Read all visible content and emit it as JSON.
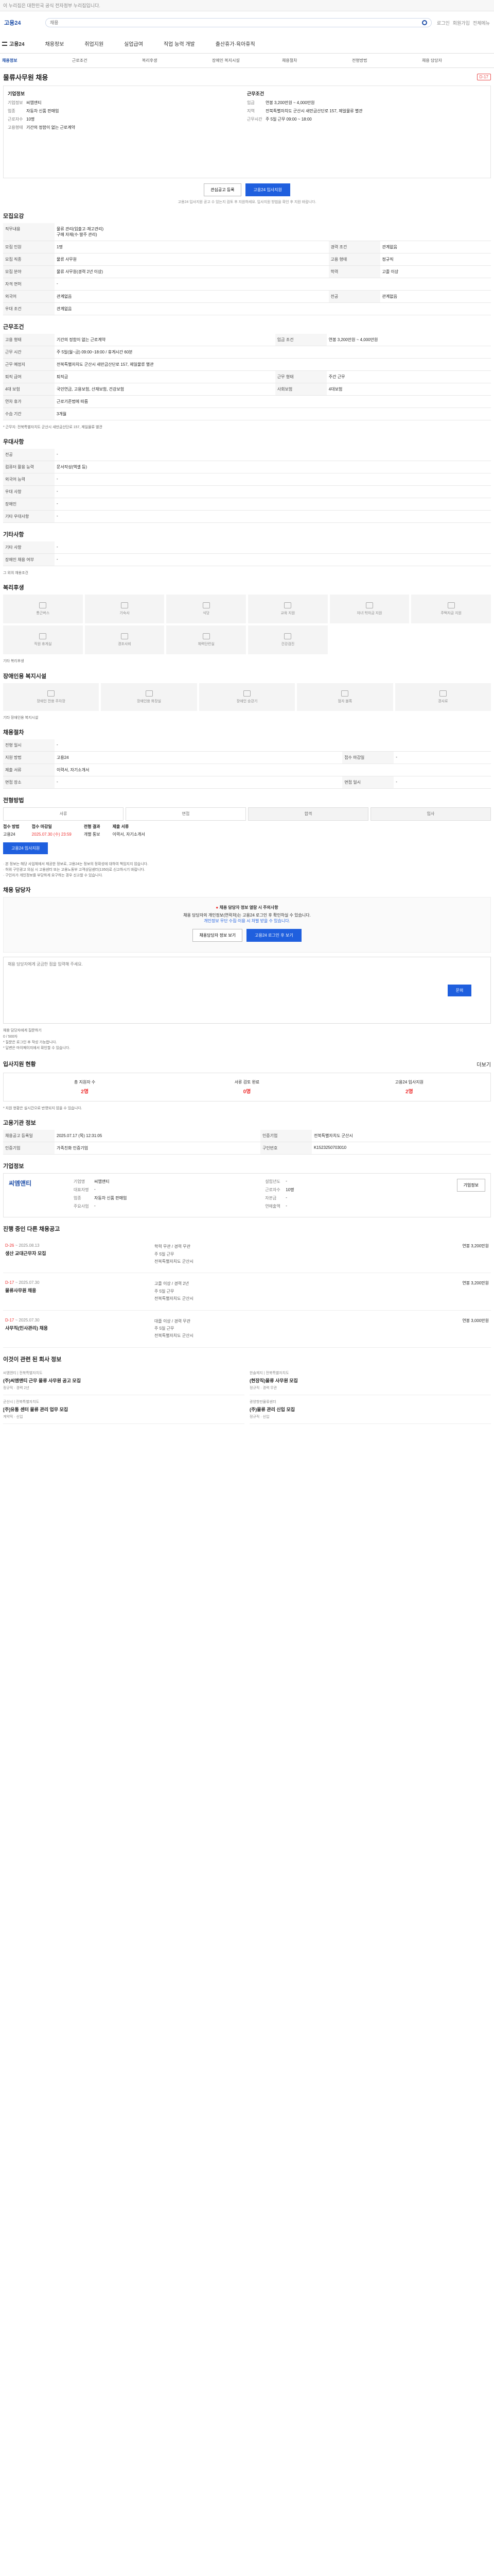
{
  "topbar": {
    "text": "이 누리집은 대한민국 공식 전자정부 누리집입니다."
  },
  "header": {
    "logo": "고용24",
    "search_placeholder": "채용",
    "icons": [
      "로그인",
      "회원가입",
      "전체메뉴"
    ]
  },
  "gnb": [
    "고용24",
    "채용정보",
    "취업지원",
    "실업급여",
    "직업 능력 개발",
    "출산휴가·육아휴직"
  ],
  "subnav": [
    "채용정보",
    "근로조건",
    "복리후생",
    "장애인 복지시설",
    "채용절차",
    "전형방법",
    "채용 담당자"
  ],
  "job": {
    "title": "물류사무원 채용",
    "dday": "D-17",
    "company_label": "기업정보",
    "company_name": "씨엠앤티",
    "industry_label": "업종",
    "industry": "자동차 신품 판매업",
    "employees_label": "근로자수",
    "employees": "10명",
    "type_label": "고용형태",
    "type": "기간의 정함이 없는 근로계약",
    "condition_title": "근무조건",
    "wage_label": "임금",
    "wage": "연봉 3,200만원 ~ 4,000만원",
    "location_label": "지역",
    "location": "전북특별자치도 군산시 새만금산단로 157, 제일물류 별관",
    "hours_label": "근무시간",
    "hours": "주 5일 근무 09:00 ~ 18:00"
  },
  "actions": {
    "bookmark": "관심공고 등록",
    "apply": "고용24 입사지원"
  },
  "notice_line": "고용24 입사지원 공고 수 있는지 검토 후 지원하세요. 입사지원 방법을 확인 후 지원 바랍니다.",
  "sections": {
    "recruit": "모집요강",
    "conditions": "근무조건",
    "welfare_area": "우대사항",
    "etc": "기타사항",
    "benefits": "복리후생",
    "disability": "장애인용 복지시설",
    "process": "채용절차",
    "method": "전형방법",
    "manager": "채용 담당자",
    "stats": "입사지원 현황",
    "info": "고용기관 정보",
    "company": "기업정보",
    "other_jobs": "진행 중인 다른 채용공고",
    "related": "이것이 관련 된 회사 정보"
  },
  "recruit_rows": [
    [
      "직무내용",
      "물류 관리(입출고·재고관리)\n구매 자재(수·발주 관리)"
    ],
    [
      "모집 인원",
      "1명",
      "경력 조건",
      "관계없음"
    ],
    [
      "모집 직종",
      "물류 사무원",
      "고용 형태",
      "정규직"
    ],
    [
      "모집 분야",
      "물류 사무원(경력 2년 이상)",
      "학력",
      "고졸 이상"
    ],
    [
      "자격 면허",
      "-"
    ],
    [
      "외국어",
      "관계없음",
      "전공",
      "관계없음"
    ],
    [
      "우대 조건",
      "관계없음"
    ]
  ],
  "cond_rows": [
    [
      "고용 형태",
      "기간의 정함이 없는 근로계약",
      "임금 조건",
      "연봉 3,200만원 ~ 4,000만원"
    ],
    [
      "근무 시간",
      "주 5일(월~금) 09:00~18:00 / 휴게시간 60분"
    ],
    [
      "근무 예정지",
      "전북특별자치도 군산시 새만금산단로 157, 제일물류 별관"
    ],
    [
      "퇴직 급여",
      "퇴직금",
      "근무 형태",
      "주간 근무"
    ],
    [
      "4대 보험",
      "국민연금, 고용보험, 산재보험, 건강보험",
      "사회보험",
      "4대보험"
    ],
    [
      "연차 휴가",
      "근로기준법에 따름"
    ],
    [
      "수습 기간",
      "3개월"
    ]
  ],
  "cond_note": "* 근무지: 전북특별자치도 군산시 새만금산단로 157, 제일물류 별관",
  "pref_rows": [
    [
      "전공",
      "-"
    ],
    [
      "컴퓨터 활용 능력",
      "문서작성(엑셀 등)"
    ],
    [
      "외국어 능력",
      "-"
    ],
    [
      "우대 사항",
      "-"
    ],
    [
      "장애인",
      "-"
    ],
    [
      "기타 우대사항",
      "-"
    ]
  ],
  "etc_rows": [
    [
      "기타 사항",
      "-"
    ],
    [
      "장애인 채용 여부",
      "-"
    ]
  ],
  "etc_note": "그 외의 채용조건",
  "benefits": [
    "통근버스",
    "기숙사",
    "식당",
    "교육 지원",
    "자녀 학자금 지원",
    "주택자금 지원",
    "직원 휴게실",
    "경조사비",
    "체력단련실",
    "건강검진"
  ],
  "benefits_note": "기타 복리후생",
  "disability_items": [
    "장애인 전용 주차장",
    "장애인용 화장실",
    "장애인 승강기",
    "점자 블록",
    "경사로"
  ],
  "disability_note": "기타 장애인용 복지시설",
  "process_rows": [
    [
      "전형 일시",
      "-"
    ],
    [
      "지원 방법",
      "고용24",
      "접수 마감일",
      "-"
    ],
    [
      "제출 서류",
      "이력서, 자기소개서"
    ],
    [
      "면접 장소",
      "-",
      "면접 일시",
      "-"
    ]
  ],
  "method_steps": [
    "서류",
    "면접",
    "합격",
    "입사"
  ],
  "dates": {
    "receipt_label": "접수 방법",
    "receipt": "고용24",
    "deadline_label": "접수 마감일",
    "deadline": "2025.07.30 (수) 23:59",
    "result_label": "전형 결과",
    "result": "개별 통보",
    "docs_label": "제출 서류",
    "docs": "이력서, 자기소개서"
  },
  "bullets": [
    "· 본 정보는 해당 사업체에서 제공한 정보로, 고용24는 정보의 정확성에 대하여 책임지지 않습니다.",
    "· 허위 구인광고 의심 시 고용센터 또는 고용노동부 고객상담센터(1350)로 신고하시기 바랍니다.",
    "· 구인자가 개인정보를 부당하게 요구하는 경우 신고할 수 있습니다."
  ],
  "manager": {
    "warn": "채용 담당자 정보 열람 시 주의사항",
    "desc1": "채용 담당자의 개인정보(연락처)는 고용24 로그인 후 확인하실 수 있습니다.",
    "desc2": "개인정보 무단 수집·이용 시 처벌 받을 수 있습니다.",
    "btn_login": "채용담당자 정보 보기",
    "btn_view": "고용24 로그인 후 보기",
    "qa_label": "채용 담당자에게 질문하기",
    "qa_count": "0 / 500자",
    "qa_placeholder": "채용 담당자에게 궁금한 점을 입력해 주세요.",
    "qa_send": "문의",
    "qa_note1": "* 질문은 로그인 후 작성 가능합니다.",
    "qa_note2": "* 답변은 마이페이지에서 확인할 수 있습니다."
  },
  "stats": {
    "link": "더보기",
    "items": [
      {
        "label": "총 지원자 수",
        "value": "2명"
      },
      {
        "label": "서류 검토 완료",
        "value": "0명"
      },
      {
        "label": "고용24 입사지원",
        "value": "2명"
      }
    ],
    "note": "* 지원 현황은 실시간으로 반영되지 않을 수 있습니다."
  },
  "info_rows": [
    [
      "채용공고 등록일",
      "2025.07.17 (목) 12:31:05",
      "인증기업",
      "전북특별자치도 군산시"
    ],
    [
      "인증기업",
      "가족친화 인증기업",
      "구인번호",
      "K1523250703010"
    ]
  ],
  "company": {
    "logo": "씨엠앤티",
    "rows_a": [
      [
        "기업명",
        "씨엠앤티"
      ],
      [
        "대표자명",
        "-"
      ],
      [
        "업종",
        "자동차 신품 판매업"
      ],
      [
        "주요사업",
        "-"
      ]
    ],
    "rows_b": [
      [
        "설립년도",
        "-"
      ],
      [
        "근로자수",
        "10명"
      ],
      [
        "자본금",
        "-"
      ],
      [
        "연매출액",
        "-"
      ]
    ],
    "btn": "기업정보"
  },
  "other_jobs": [
    {
      "dday": "D-26",
      "period": "~ 2025.08.13",
      "title": "생산 교대근무자 모집",
      "m1": "학력 무관 / 경력 무관",
      "m2": "주 5일 근무",
      "m3": "전북특별자치도 군산시",
      "wage": "연봉 3,200만원"
    },
    {
      "dday": "D-17",
      "period": "~ 2025.07.30",
      "title": "물류사무원 채용",
      "m1": "고졸 이상 / 경력 2년",
      "m2": "주 5일 근무",
      "m3": "전북특별자치도 군산시",
      "wage": "연봉 3,200만원"
    },
    {
      "dday": "D-17",
      "period": "~ 2025.07.30",
      "title": "사무직(인사관리) 채용",
      "m1": "대졸 이상 / 경력 무관",
      "m2": "주 5일 근무",
      "m3": "전북특별자치도 군산시",
      "wage": "연봉 3,000만원"
    }
  ],
  "related": [
    {
      "sub": "씨엠앤티 | 전북특별자치도",
      "title": "(주)씨엠앤티 근무 물류 사무원 공고 모집",
      "tags": "정규직 · 경력 2년"
    },
    {
      "sub": "한솔제지 | 전북특별자치도",
      "title": "(현장직)물류 사무원 모집",
      "tags": "정규직 · 경력 무관"
    },
    {
      "sub": "군산시 | 전북특별자치도",
      "title": "[주]유통 센터 물류 관리 업무 모집",
      "tags": "계약직 · 신입"
    },
    {
      "sub": "광양항만물류센터",
      "title": "(주)물류 관리 신입 모집",
      "tags": "정규직 · 신입"
    }
  ]
}
